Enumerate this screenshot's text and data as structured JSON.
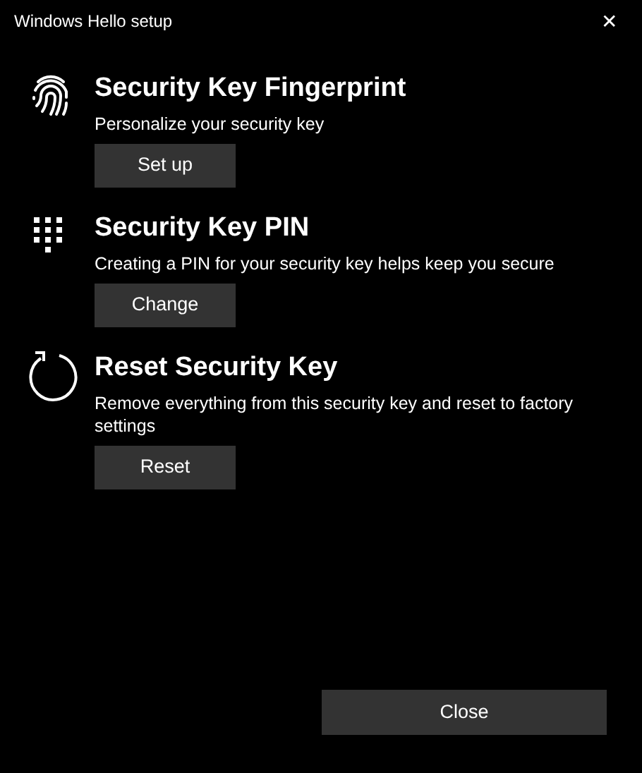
{
  "window": {
    "title": "Windows Hello setup",
    "close_glyph": "✕"
  },
  "sections": [
    {
      "kind": "fingerprint",
      "heading": "Security Key Fingerprint",
      "description": "Personalize your security key",
      "button": "Set up"
    },
    {
      "kind": "pin",
      "heading": "Security Key PIN",
      "description": "Creating a PIN for your security key helps keep you secure",
      "button": "Change"
    },
    {
      "kind": "reset",
      "heading": "Reset Security Key",
      "description": "Remove everything from this security key and reset to factory settings",
      "button": "Reset"
    }
  ],
  "footer_button": "Close"
}
